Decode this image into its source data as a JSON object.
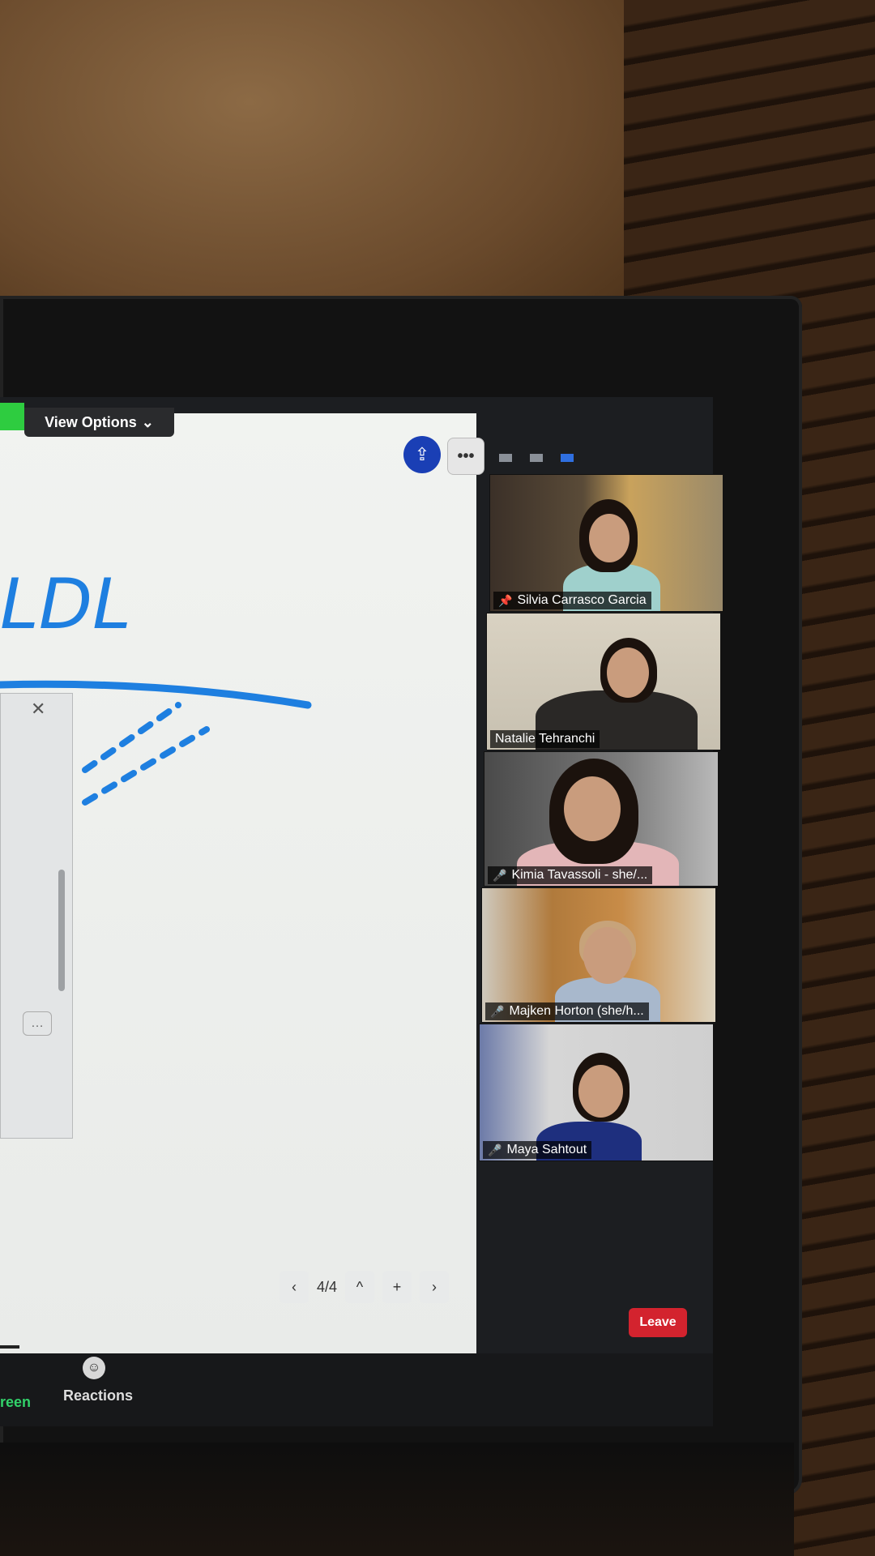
{
  "meeting": {
    "view_options_label": "View Options",
    "page_indicator": "4/4",
    "leave_label": "Leave",
    "toolbar": {
      "share_partial_label": "reen",
      "reactions_label": "Reactions"
    }
  },
  "whiteboard": {
    "handwriting_text": "LDL"
  },
  "participants": [
    {
      "name": "Silvia Carrasco Garcia",
      "pinned": true,
      "muted": false
    },
    {
      "name": "Natalie Tehranchi",
      "pinned": false,
      "muted": false
    },
    {
      "name": "Kimia Tavassoli - she/...",
      "pinned": false,
      "muted": true
    },
    {
      "name": "Majken Horton (she/h...",
      "pinned": false,
      "muted": true
    },
    {
      "name": "Maya Sahtout",
      "pinned": false,
      "muted": true
    }
  ],
  "colors": {
    "accent_blue": "#1a3fb5",
    "ink_blue": "#1e7fe0",
    "leave_red": "#d3232e",
    "share_green": "#32d16a"
  }
}
